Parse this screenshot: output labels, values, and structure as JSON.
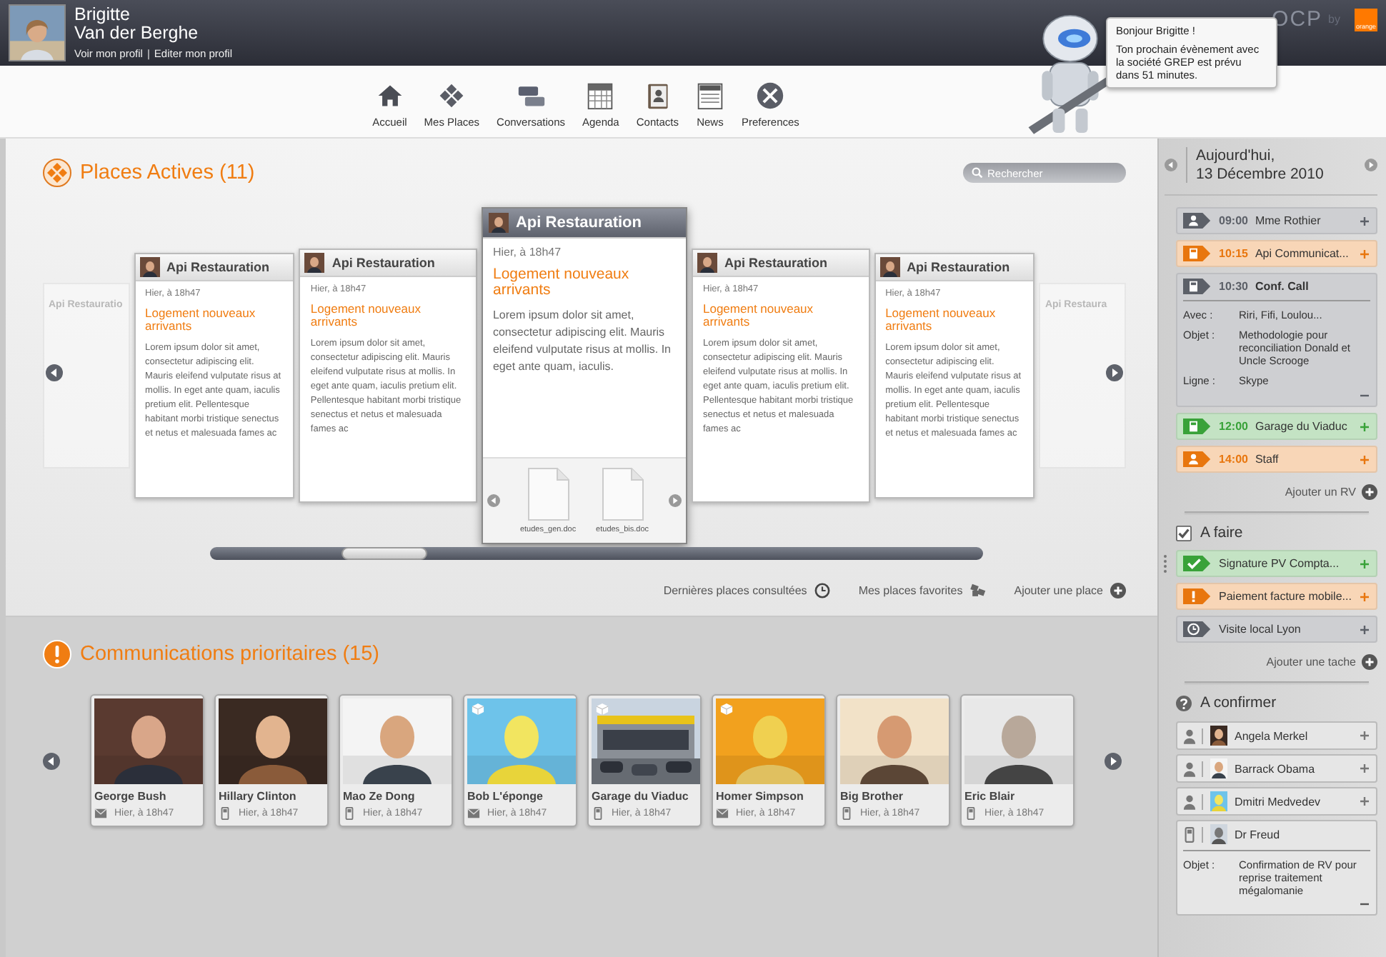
{
  "user": {
    "first_name": "Brigitte",
    "last_name": "Van der Berghe",
    "links": [
      "Voir mon profil",
      "Editer mon profil"
    ],
    "separator": "|"
  },
  "brand": {
    "logo": "OCP",
    "by": "by",
    "badge": "orange"
  },
  "assistant": {
    "greeting": "Bonjour Brigitte !",
    "message": "Ton prochain évènement avec la société GREP est prévu dans 51 minutes."
  },
  "nav": [
    {
      "label": "Accueil",
      "kind": "home"
    },
    {
      "label": "Mes Places",
      "kind": "places"
    },
    {
      "label": "Conversations",
      "kind": "chat"
    },
    {
      "label": "Agenda",
      "kind": "calendar"
    },
    {
      "label": "Contacts",
      "kind": "contacts"
    },
    {
      "label": "News",
      "kind": "news"
    },
    {
      "label": "Preferences",
      "kind": "settings"
    }
  ],
  "places": {
    "title": "Places Actives (11)",
    "search_placeholder": "Rechercher",
    "side_cards": [
      {
        "title": "Api Restauratio"
      },
      {
        "title": "Api Restaura"
      }
    ],
    "cards": [
      {
        "title": "Api Restauration",
        "date": "Hier, à 18h47",
        "headline": "Logement nouveaux arrivants",
        "body": "Lorem ipsum dolor sit amet, consectetur adipiscing elit. Mauris eleifend vulputate risus at mollis. In eget ante quam, iaculis pretium elit. Pellentesque habitant morbi tristique senectus et netus et malesuada fames ac",
        "selected": false
      },
      {
        "title": "Api Restauration",
        "date": "Hier, à 18h47",
        "headline": "Logement nouveaux arrivants",
        "body": "Lorem ipsum dolor sit amet, consectetur adipiscing elit. Mauris eleifend vulputate risus at mollis. In eget ante quam, iaculis pretium elit. Pellentesque habitant morbi tristique senectus et netus et malesuada fames ac",
        "selected": false
      },
      {
        "title": "Api Restauration",
        "date": "Hier, à 18h47",
        "headline": "Logement nouveaux arrivants",
        "body": "Lorem ipsum dolor sit amet, consectetur adipiscing elit. Mauris eleifend vulputate risus at mollis. In eget ante quam, iaculis.",
        "selected": true,
        "files": [
          "etudes_gen.doc",
          "etudes_bis.doc"
        ]
      },
      {
        "title": "Api Restauration",
        "date": "Hier, à 18h47",
        "headline": "Logement nouveaux arrivants",
        "body": "Lorem ipsum dolor sit amet, consectetur adipiscing elit. Mauris eleifend vulputate risus at mollis. In eget ante quam, iaculis pretium elit. Pellentesque habitant morbi tristique senectus et netus et malesuada fames ac",
        "selected": false
      },
      {
        "title": "Api Restauration",
        "date": "Hier, à 18h47",
        "headline": "Logement nouveaux arrivants",
        "body": "Lorem ipsum dolor sit amet, consectetur adipiscing elit. Mauris eleifend vulputate risus at mollis. In eget ante quam, iaculis pretium elit. Pellentesque habitant morbi tristique senectus et netus et malesuada fames ac",
        "selected": false
      }
    ],
    "links": [
      {
        "label": "Dernières places consultées",
        "kind": "clock"
      },
      {
        "label": "Mes places favorites",
        "kind": "cubes"
      },
      {
        "label": "Ajouter une place",
        "kind": "add"
      }
    ]
  },
  "communications": {
    "title": "Communications prioritaires (15)",
    "items": [
      {
        "name": "George Bush",
        "time": "Hier, à 18h47",
        "kind": "mail",
        "tagged": false
      },
      {
        "name": "Hillary Clinton",
        "time": "Hier, à 18h47",
        "kind": "phone",
        "tagged": false
      },
      {
        "name": "Mao Ze Dong",
        "time": "Hier, à 18h47",
        "kind": "phone",
        "tagged": false
      },
      {
        "name": "Bob L'éponge",
        "time": "Hier, à 18h47",
        "kind": "mail",
        "tagged": true
      },
      {
        "name": "Garage du Viaduc",
        "time": "Hier, à 18h47",
        "kind": "phone",
        "tagged": true
      },
      {
        "name": "Homer Simpson",
        "time": "Hier, à 18h47",
        "kind": "mail",
        "tagged": true
      },
      {
        "name": "Big Brother",
        "time": "Hier, à 18h47",
        "kind": "phone",
        "tagged": false
      },
      {
        "name": "Eric Blair",
        "time": "Hier, à 18h47",
        "kind": "phone",
        "tagged": false
      }
    ]
  },
  "agenda": {
    "day": "Aujourd'hui,",
    "date": "13 Décembre 2010",
    "events": [
      {
        "kind": "person",
        "color": "#5c6068",
        "time": "09:00",
        "title": "Mme Rothier",
        "expanded": false
      },
      {
        "kind": "doc",
        "color": "#e8760e",
        "time": "10:15",
        "title": "Api Communicat...",
        "expanded": false
      },
      {
        "kind": "doc",
        "color": "#5c6068",
        "time": "10:30",
        "title": "Conf. Call",
        "expanded": true,
        "details": [
          {
            "label": "Avec :",
            "value": "Riri, Fifi, Loulou..."
          },
          {
            "label": "Objet :",
            "value": "Methodologie pour reconciliation Donald et Uncle Scrooge"
          },
          {
            "label": "Ligne :",
            "value": "Skype"
          }
        ]
      },
      {
        "kind": "doc",
        "color": "#39a239",
        "time": "12:00",
        "title": "Garage du Viaduc",
        "expanded": false
      },
      {
        "kind": "person",
        "color": "#e8760e",
        "time": "14:00",
        "title": "Staff",
        "expanded": false
      }
    ],
    "add_label": "Ajouter un RV"
  },
  "tasks": {
    "title": "A faire",
    "checked": true,
    "items": [
      {
        "kind": "check",
        "color": "#39a239",
        "title": "Signature PV Compta..."
      },
      {
        "kind": "alert",
        "color": "#e8760e",
        "title": "Paiement facture mobile..."
      },
      {
        "kind": "clock",
        "color": "#5c6068",
        "title": "Visite local Lyon"
      }
    ],
    "add_label": "Ajouter une tache"
  },
  "confirm": {
    "title": "A confirmer",
    "items": [
      {
        "kind": "person",
        "name": "Angela Merkel",
        "expanded": false
      },
      {
        "kind": "person",
        "name": "Barrack Obama",
        "expanded": false
      },
      {
        "kind": "person",
        "name": "Dmitri Medvedev",
        "expanded": false
      },
      {
        "kind": "phone",
        "name": "Dr Freud",
        "expanded": true,
        "details": [
          {
            "label": "Objet :",
            "value": "Confirmation de RV pour reprise traitement mégalomanie"
          }
        ]
      }
    ]
  }
}
